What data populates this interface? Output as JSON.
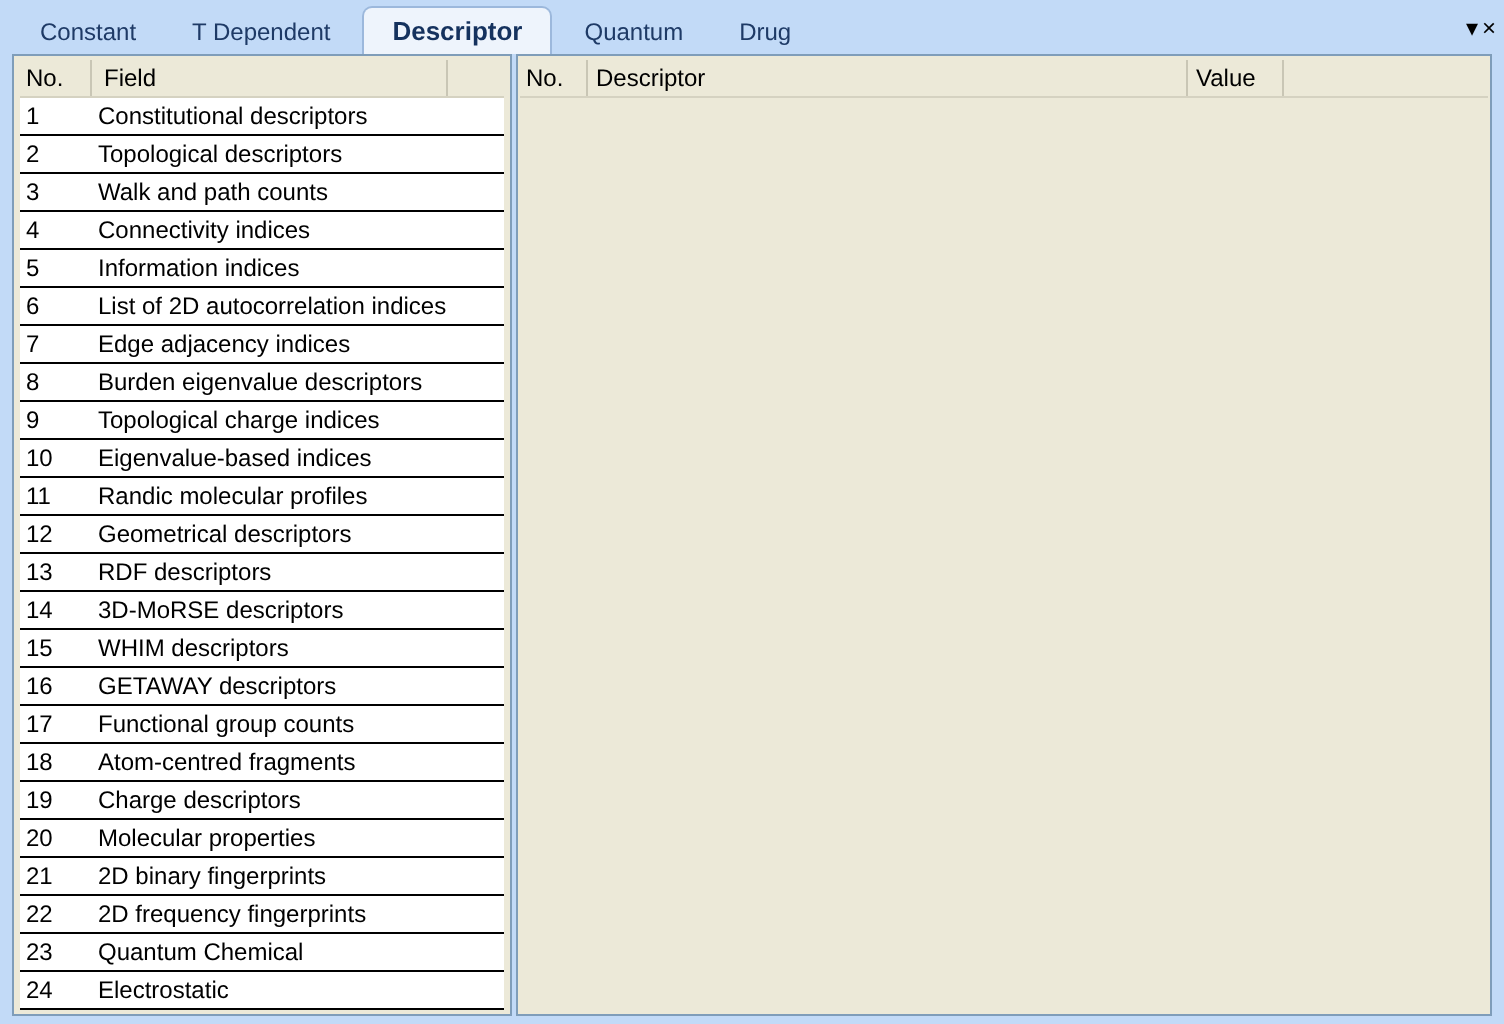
{
  "tabs": [
    {
      "label": "Constant",
      "selected": false
    },
    {
      "label": "T Dependent",
      "selected": false
    },
    {
      "label": "Descriptor",
      "selected": true
    },
    {
      "label": "Quantum",
      "selected": false
    },
    {
      "label": "Drug",
      "selected": false
    }
  ],
  "window_controls": {
    "menu": "▾",
    "close": "×"
  },
  "fields_table": {
    "columns": [
      "No.",
      "Field"
    ],
    "rows": [
      [
        "1",
        "Constitutional descriptors"
      ],
      [
        "2",
        "Topological descriptors"
      ],
      [
        "3",
        "Walk and path counts"
      ],
      [
        "4",
        "Connectivity indices"
      ],
      [
        "5",
        "Information indices"
      ],
      [
        "6",
        "List of 2D autocorrelation indices"
      ],
      [
        "7",
        "Edge adjacency indices"
      ],
      [
        "8",
        "Burden eigenvalue descriptors"
      ],
      [
        "9",
        "Topological charge indices"
      ],
      [
        "10",
        "Eigenvalue-based indices"
      ],
      [
        "11",
        "Randic molecular profiles"
      ],
      [
        "12",
        "Geometrical descriptors"
      ],
      [
        "13",
        "RDF descriptors"
      ],
      [
        "14",
        "3D-MoRSE descriptors"
      ],
      [
        "15",
        "WHIM descriptors"
      ],
      [
        "16",
        "GETAWAY descriptors"
      ],
      [
        "17",
        "Functional group counts"
      ],
      [
        "18",
        "Atom-centred fragments"
      ],
      [
        "19",
        "Charge descriptors"
      ],
      [
        "20",
        "Molecular properties"
      ],
      [
        "21",
        "2D binary fingerprints"
      ],
      [
        "22",
        "2D frequency fingerprints"
      ],
      [
        "23",
        "Quantum Chemical"
      ],
      [
        "24",
        "Electrostatic"
      ]
    ]
  },
  "descriptors_table": {
    "columns": [
      "No.",
      "Descriptor",
      "Value"
    ]
  }
}
